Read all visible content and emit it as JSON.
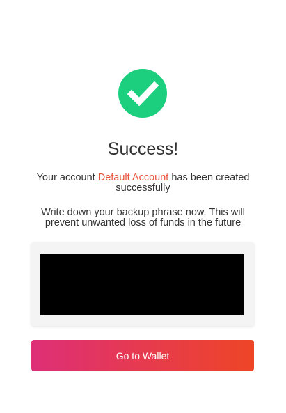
{
  "colors": {
    "success_green": "#1ccf7f",
    "account_name": "#e5533a",
    "phrase_mask": "#000000",
    "button_gradient_start": "#de2f77",
    "button_gradient_end": "#ee4527"
  },
  "status": {
    "icon": "checkmark-circle-icon",
    "title": "Success!"
  },
  "account_message": {
    "prefix": "Your account ",
    "account_name": "Default Account",
    "suffix": " has been created successfully"
  },
  "backup_note": "Write down your backup phrase now. This will prevent unwanted loss of funds in the future",
  "backup_phrase": {
    "hidden": true
  },
  "actions": {
    "go_to_wallet": "Go to Wallet"
  }
}
